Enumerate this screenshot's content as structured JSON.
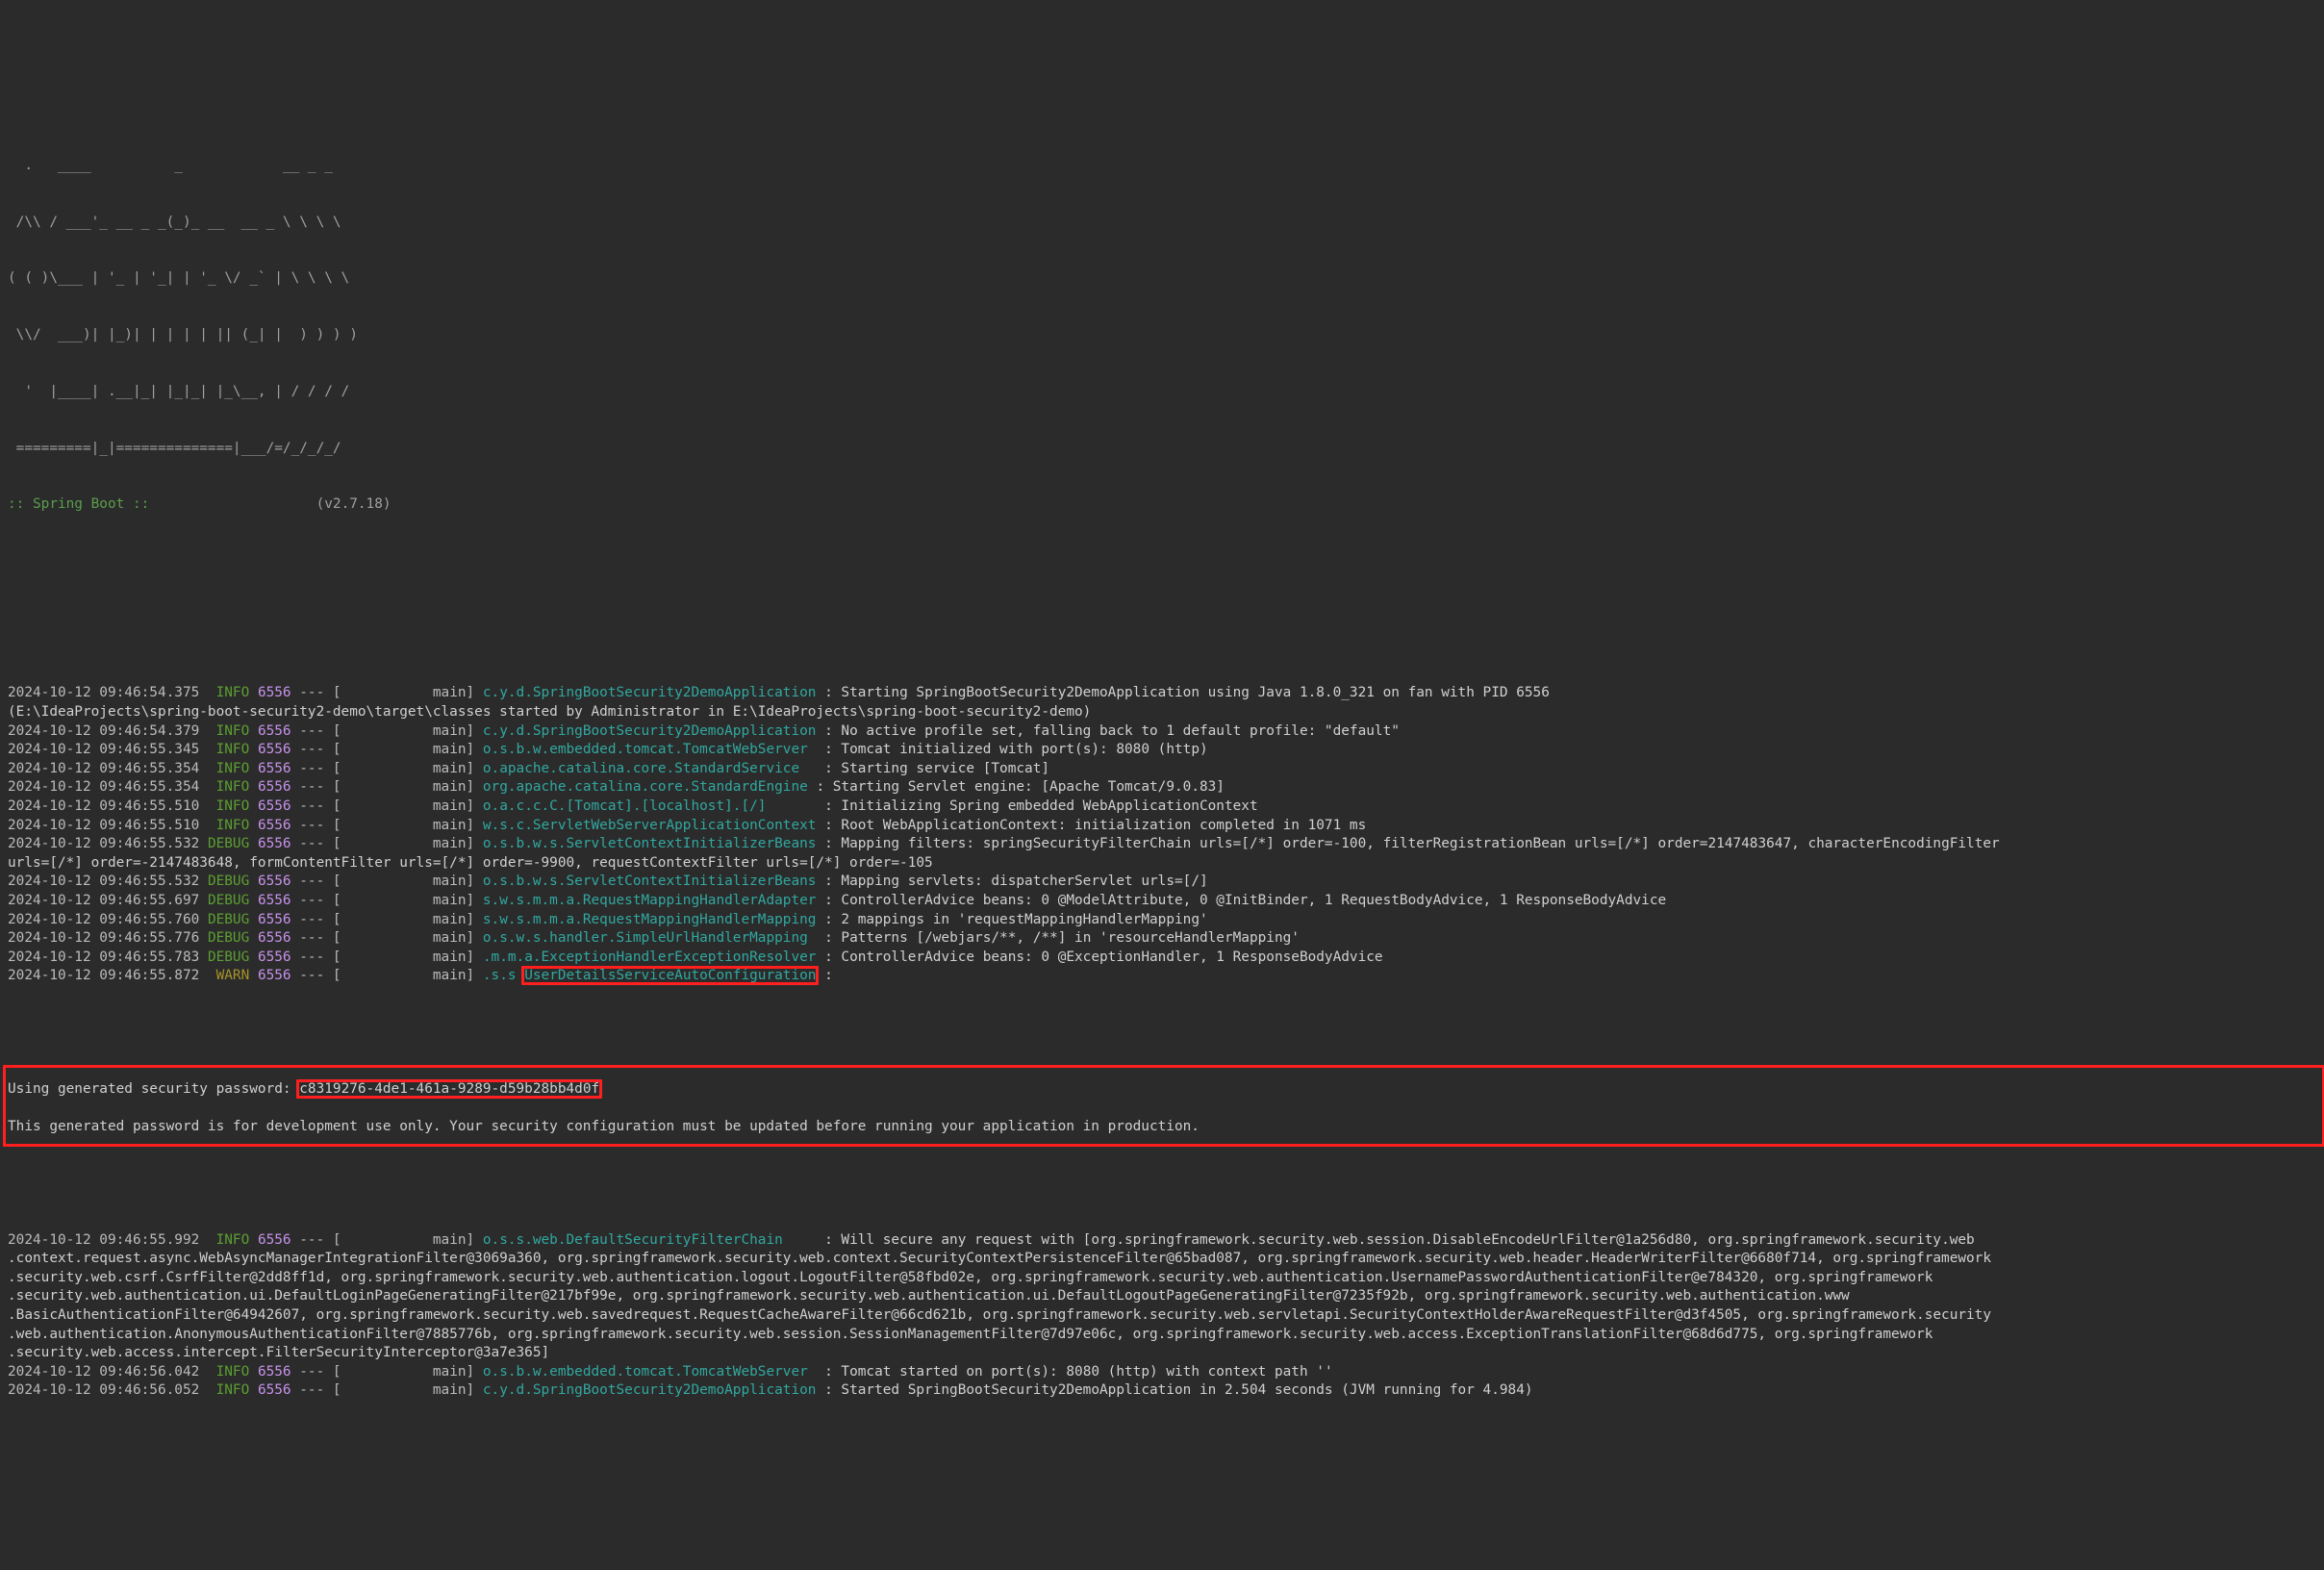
{
  "terminal": {
    "background": "#2b2b2b",
    "foreground": "#d0d0d0",
    "accent_annotation": "#ff1f1f",
    "level_info_color": "#5c9e31",
    "level_debug_color": "#5c9e31",
    "level_warn_color": "#a6922a",
    "pid_color": "#c792ea",
    "logger_color": "#31a8a0"
  },
  "banner": {
    "lines": [
      "  .   ____          _            __ _ _",
      " /\\\\ / ___'_ __ _ _(_)_ __  __ _ \\ \\ \\ \\",
      "( ( )\\___ | '_ | '_| | '_ \\/ _` | \\ \\ \\ \\",
      " \\\\/  ___)| |_)| | | | | || (_| |  ) ) ) )",
      "  '  |____| .__|_| |_|_| |_\\__, | / / / /",
      " =========|_|==============|___/=/_/_/_/"
    ],
    "version_label": ":: Spring Boot ::",
    "version_value": "(v2.7.18)"
  },
  "annotations": {
    "logger_highlight": "UserDetailsServiceAutoConfiguration",
    "password_highlight": "c8319276-4de1-461a-9289-d59b28bb4d0f",
    "section_highlight": "generated-security-password-block"
  },
  "log": {
    "entries": [
      {
        "timestamp": "2024-10-12 09:46:54.375",
        "level": "INFO",
        "level_pad": " ",
        "pid": "6556",
        "sep": "---",
        "thread": "[           main]",
        "logger": "c.y.d.SpringBootSecurity2DemoApplication",
        "logger_pad": " ",
        "message": ": Starting SpringBootSecurity2DemoApplication using Java 1.8.0_321 on fan with PID 6556"
      },
      {
        "continuation": "(E:\\IdeaProjects\\spring-boot-security2-demo\\target\\classes started by Administrator in E:\\IdeaProjects\\spring-boot-security2-demo)"
      },
      {
        "timestamp": "2024-10-12 09:46:54.379",
        "level": "INFO",
        "level_pad": " ",
        "pid": "6556",
        "sep": "---",
        "thread": "[           main]",
        "logger": "c.y.d.SpringBootSecurity2DemoApplication",
        "logger_pad": " ",
        "message": ": No active profile set, falling back to 1 default profile: \"default\""
      },
      {
        "timestamp": "2024-10-12 09:46:55.345",
        "level": "INFO",
        "level_pad": " ",
        "pid": "6556",
        "sep": "---",
        "thread": "[           main]",
        "logger": "o.s.b.w.embedded.tomcat.TomcatWebServer",
        "logger_pad": "  ",
        "message": ": Tomcat initialized with port(s): 8080 (http)"
      },
      {
        "timestamp": "2024-10-12 09:46:55.354",
        "level": "INFO",
        "level_pad": " ",
        "pid": "6556",
        "sep": "---",
        "thread": "[           main]",
        "logger": "o.apache.catalina.core.StandardService",
        "logger_pad": "   ",
        "message": ": Starting service [Tomcat]"
      },
      {
        "timestamp": "2024-10-12 09:46:55.354",
        "level": "INFO",
        "level_pad": " ",
        "pid": "6556",
        "sep": "---",
        "thread": "[           main]",
        "logger": "org.apache.catalina.core.StandardEngine",
        "logger_pad": " ",
        "message": ": Starting Servlet engine: [Apache Tomcat/9.0.83]"
      },
      {
        "timestamp": "2024-10-12 09:46:55.510",
        "level": "INFO",
        "level_pad": " ",
        "pid": "6556",
        "sep": "---",
        "thread": "[           main]",
        "logger": "o.a.c.c.C.[Tomcat].[localhost].[/]",
        "logger_pad": "       ",
        "message": ": Initializing Spring embedded WebApplicationContext"
      },
      {
        "timestamp": "2024-10-12 09:46:55.510",
        "level": "INFO",
        "level_pad": " ",
        "pid": "6556",
        "sep": "---",
        "thread": "[           main]",
        "logger": "w.s.c.ServletWebServerApplicationContext",
        "logger_pad": " ",
        "message": ": Root WebApplicationContext: initialization completed in 1071 ms"
      },
      {
        "timestamp": "2024-10-12 09:46:55.532",
        "level": "DEBUG",
        "level_pad": "",
        "pid": "6556",
        "sep": "---",
        "thread": "[           main]",
        "logger": "o.s.b.w.s.ServletContextInitializerBeans",
        "logger_pad": " ",
        "message": ": Mapping filters: springSecurityFilterChain urls=[/*] order=-100, filterRegistrationBean urls=[/*] order=2147483647, characterEncodingFilter"
      },
      {
        "continuation": "urls=[/*] order=-2147483648, formContentFilter urls=[/*] order=-9900, requestContextFilter urls=[/*] order=-105"
      },
      {
        "timestamp": "2024-10-12 09:46:55.532",
        "level": "DEBUG",
        "level_pad": "",
        "pid": "6556",
        "sep": "---",
        "thread": "[           main]",
        "logger": "o.s.b.w.s.ServletContextInitializerBeans",
        "logger_pad": " ",
        "message": ": Mapping servlets: dispatcherServlet urls=[/]"
      },
      {
        "timestamp": "2024-10-12 09:46:55.697",
        "level": "DEBUG",
        "level_pad": "",
        "pid": "6556",
        "sep": "---",
        "thread": "[           main]",
        "logger": "s.w.s.m.m.a.RequestMappingHandlerAdapter",
        "logger_pad": " ",
        "message": ": ControllerAdvice beans: 0 @ModelAttribute, 0 @InitBinder, 1 RequestBodyAdvice, 1 ResponseBodyAdvice"
      },
      {
        "timestamp": "2024-10-12 09:46:55.760",
        "level": "DEBUG",
        "level_pad": "",
        "pid": "6556",
        "sep": "---",
        "thread": "[           main]",
        "logger": "s.w.s.m.m.a.RequestMappingHandlerMapping",
        "logger_pad": " ",
        "message": ": 2 mappings in 'requestMappingHandlerMapping'"
      },
      {
        "timestamp": "2024-10-12 09:46:55.776",
        "level": "DEBUG",
        "level_pad": "",
        "pid": "6556",
        "sep": "---",
        "thread": "[           main]",
        "logger": "o.s.w.s.handler.SimpleUrlHandlerMapping",
        "logger_pad": "  ",
        "message": ": Patterns [/webjars/**, /**] in 'resourceHandlerMapping'"
      },
      {
        "timestamp": "2024-10-12 09:46:55.783",
        "level": "DEBUG",
        "level_pad": "",
        "pid": "6556",
        "sep": "---",
        "thread": "[           main]",
        "logger": ".m.m.a.ExceptionHandlerExceptionResolver",
        "logger_pad": " ",
        "message": ": ControllerAdvice beans: 0 @ExceptionHandler, 1 ResponseBodyAdvice"
      },
      {
        "timestamp": "2024-10-12 09:46:55.872",
        "level": "WARN",
        "level_pad": " ",
        "pid": "6556",
        "sep": "---",
        "thread": "[           main]",
        "logger_prefix": ".s.s ",
        "logger_boxed": "UserDetailsServiceAutoConfiguration",
        "logger_pad": " ",
        "message": ":"
      }
    ],
    "password_block": {
      "blank_before": "",
      "prefix": "Using generated security password: ",
      "password": "c8319276-4de1-461a-9289-d59b28bb4d0f",
      "blank_middle": "",
      "notice": "This generated password is for development use only. Your security configuration must be updated before running your application in production.",
      "blank_after": ""
    },
    "entries_after": [
      {
        "timestamp": "2024-10-12 09:46:55.992",
        "level": "INFO",
        "level_pad": " ",
        "pid": "6556",
        "sep": "---",
        "thread": "[           main]",
        "logger": "o.s.s.web.DefaultSecurityFilterChain",
        "logger_pad": "     ",
        "message": ": Will secure any request with [org.springframework.security.web.session.DisableEncodeUrlFilter@1a256d80, org.springframework.security.web"
      },
      {
        "continuation": ".context.request.async.WebAsyncManagerIntegrationFilter@3069a360, org.springframework.security.web.context.SecurityContextPersistenceFilter@65bad087, org.springframework.security.web.header.HeaderWriterFilter@6680f714, org.springframework"
      },
      {
        "continuation": ".security.web.csrf.CsrfFilter@2dd8ff1d, org.springframework.security.web.authentication.logout.LogoutFilter@58fbd02e, org.springframework.security.web.authentication.UsernamePasswordAuthenticationFilter@e784320, org.springframework"
      },
      {
        "continuation": ".security.web.authentication.ui.DefaultLoginPageGeneratingFilter@217bf99e, org.springframework.security.web.authentication.ui.DefaultLogoutPageGeneratingFilter@7235f92b, org.springframework.security.web.authentication.www"
      },
      {
        "continuation": ".BasicAuthenticationFilter@64942607, org.springframework.security.web.savedrequest.RequestCacheAwareFilter@66cd621b, org.springframework.security.web.servletapi.SecurityContextHolderAwareRequestFilter@d3f4505, org.springframework.security"
      },
      {
        "continuation": ".web.authentication.AnonymousAuthenticationFilter@7885776b, org.springframework.security.web.session.SessionManagementFilter@7d97e06c, org.springframework.security.web.access.ExceptionTranslationFilter@68d6d775, org.springframework"
      },
      {
        "continuation": ".security.web.access.intercept.FilterSecurityInterceptor@3a7e365]"
      },
      {
        "timestamp": "2024-10-12 09:46:56.042",
        "level": "INFO",
        "level_pad": " ",
        "pid": "6556",
        "sep": "---",
        "thread": "[           main]",
        "logger": "o.s.b.w.embedded.tomcat.TomcatWebServer",
        "logger_pad": "  ",
        "message": ": Tomcat started on port(s): 8080 (http) with context path ''"
      },
      {
        "timestamp": "2024-10-12 09:46:56.052",
        "level": "INFO",
        "level_pad": " ",
        "pid": "6556",
        "sep": "---",
        "thread": "[           main]",
        "logger": "c.y.d.SpringBootSecurity2DemoApplication",
        "logger_pad": " ",
        "message": ": Started SpringBootSecurity2DemoApplication in 2.504 seconds (JVM running for 4.984)"
      }
    ]
  }
}
